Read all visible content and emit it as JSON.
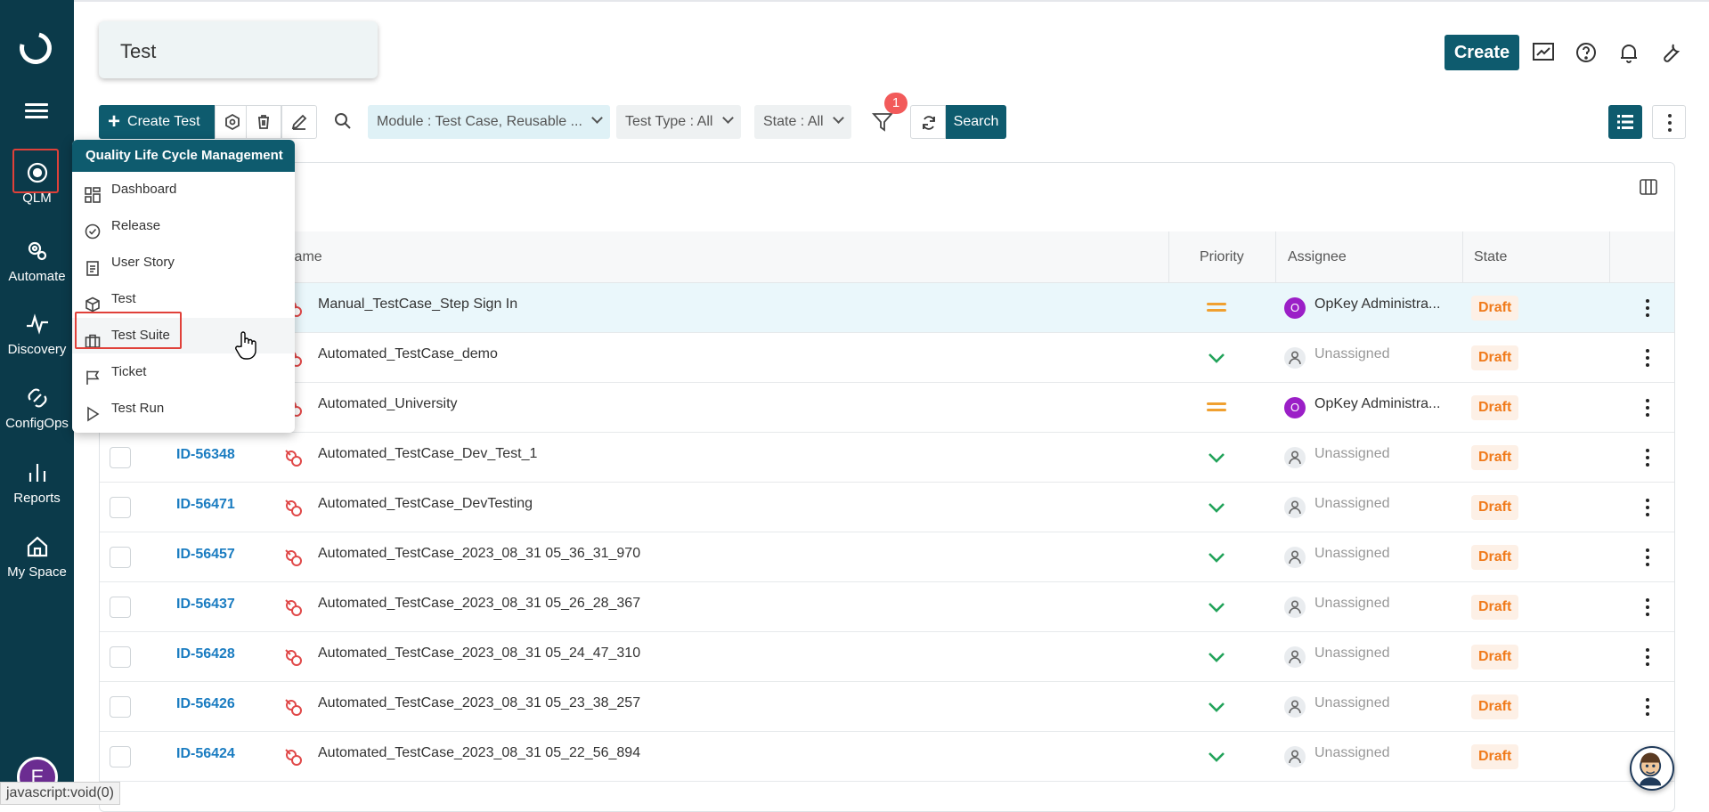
{
  "app": {
    "page_title": "Test",
    "create_label": "Create"
  },
  "nav": {
    "items": [
      {
        "label": "QLM",
        "icon": "qlm-icon"
      },
      {
        "label": "Automate",
        "icon": "automate-gear-icon"
      },
      {
        "label": "Discovery",
        "icon": "pulse-icon"
      },
      {
        "label": "ConfigOps",
        "icon": "link-icon"
      },
      {
        "label": "Reports",
        "icon": "bar-chart-icon"
      },
      {
        "label": "My Space",
        "icon": "home-icon"
      }
    ],
    "avatar_letter": "E"
  },
  "toolbar": {
    "create_test_label": "Create Test",
    "filters": [
      {
        "label": "Module :",
        "value": "Test Case, Reusable ..."
      },
      {
        "label": "Test Type :",
        "value": "All"
      },
      {
        "label": "State :",
        "value": "All"
      }
    ],
    "filter_badge": "1",
    "search_label": "Search"
  },
  "table": {
    "headers": {
      "name": "Name",
      "priority": "Priority",
      "assignee": "Assignee",
      "state": "State"
    },
    "rows": [
      {
        "id": "",
        "name": "Manual_TestCase_Step Sign In",
        "priority": "medium",
        "assignee": "OpKey Administra...",
        "state": "Draft"
      },
      {
        "id": "",
        "name": "Automated_TestCase_demo",
        "priority": "low",
        "assignee": "Unassigned",
        "state": "Draft"
      },
      {
        "id": "",
        "name": "Automated_University",
        "priority": "medium",
        "assignee": "OpKey Administra...",
        "state": "Draft"
      },
      {
        "id": "ID-56348",
        "name": "Automated_TestCase_Dev_Test_1",
        "priority": "low",
        "assignee": "Unassigned",
        "state": "Draft"
      },
      {
        "id": "ID-56471",
        "name": "Automated_TestCase_DevTesting",
        "priority": "low",
        "assignee": "Unassigned",
        "state": "Draft"
      },
      {
        "id": "ID-56457",
        "name": "Automated_TestCase_2023_08_31 05_36_31_970",
        "priority": "low",
        "assignee": "Unassigned",
        "state": "Draft"
      },
      {
        "id": "ID-56437",
        "name": "Automated_TestCase_2023_08_31 05_26_28_367",
        "priority": "low",
        "assignee": "Unassigned",
        "state": "Draft"
      },
      {
        "id": "ID-56428",
        "name": "Automated_TestCase_2023_08_31 05_24_47_310",
        "priority": "low",
        "assignee": "Unassigned",
        "state": "Draft"
      },
      {
        "id": "ID-56426",
        "name": "Automated_TestCase_2023_08_31 05_23_38_257",
        "priority": "low",
        "assignee": "Unassigned",
        "state": "Draft"
      },
      {
        "id": "ID-56424",
        "name": "Automated_TestCase_2023_08_31 05_22_56_894",
        "priority": "low",
        "assignee": "Unassigned",
        "state": "Draft"
      }
    ]
  },
  "menu": {
    "title": "Quality Life Cycle Management",
    "items": [
      {
        "label": "Dashboard",
        "icon": "dashboard-grid-icon"
      },
      {
        "label": "Release",
        "icon": "release-check-icon"
      },
      {
        "label": "User Story",
        "icon": "document-icon"
      },
      {
        "label": "Test",
        "icon": "cube-icon"
      },
      {
        "label": "Test Suite",
        "icon": "briefcase-icon"
      },
      {
        "label": "Ticket",
        "icon": "flag-icon"
      },
      {
        "label": "Test Run",
        "icon": "play-icon"
      }
    ]
  },
  "status_bar": "javascript:void(0)",
  "colors": {
    "nav_bg": "#0b3a4a",
    "primary": "#0e5b6e",
    "draft": "#f07a1a",
    "link": "#1a7cc1",
    "highlight_box": "#e0413a"
  }
}
